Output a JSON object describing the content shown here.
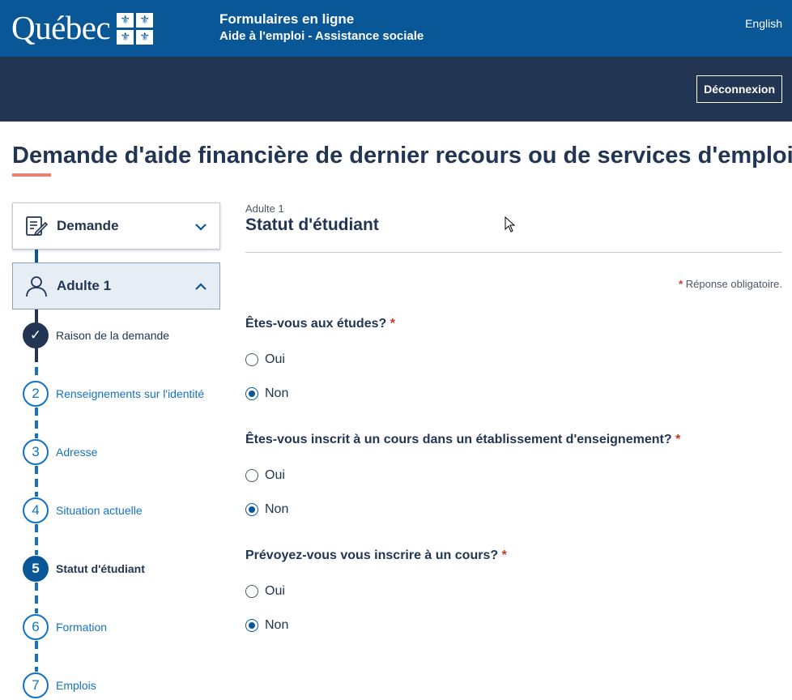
{
  "header": {
    "logo_text": "Québec",
    "app_title": "Formulaires en ligne",
    "app_subtitle": "Aide à l'emploi - Assistance sociale",
    "language_link": "English",
    "logout_label": "Déconnexion"
  },
  "page": {
    "title": "Demande d'aide financière de dernier recours ou de services d'emploi"
  },
  "sidebar": {
    "sections": [
      {
        "label": "Demande",
        "icon": "form-edit-icon",
        "expanded": false
      },
      {
        "label": "Adulte 1",
        "icon": "person-icon",
        "expanded": true
      }
    ],
    "steps": [
      {
        "number": "✓",
        "label": "Raison de la demande",
        "state": "done"
      },
      {
        "number": "2",
        "label": "Renseignements sur l'identité",
        "state": "todo"
      },
      {
        "number": "3",
        "label": "Adresse",
        "state": "todo"
      },
      {
        "number": "4",
        "label": "Situation actuelle",
        "state": "todo"
      },
      {
        "number": "5",
        "label": "Statut d'étudiant",
        "state": "current"
      },
      {
        "number": "6",
        "label": "Formation",
        "state": "todo"
      },
      {
        "number": "7",
        "label": "Emplois",
        "state": "todo"
      }
    ]
  },
  "form": {
    "kicker": "Adulte 1",
    "title": "Statut d'étudiant",
    "required_star": "*",
    "required_note": "Réponse obligatoire.",
    "questions": [
      {
        "label": "Êtes-vous aux études?",
        "options": [
          "Oui",
          "Non"
        ],
        "selected": "Non"
      },
      {
        "label": "Êtes-vous inscrit à un cours dans un établissement d'enseignement?",
        "options": [
          "Oui",
          "Non"
        ],
        "selected": "Non"
      },
      {
        "label": "Prévoyez-vous vous inscrire à un cours?",
        "options": [
          "Oui",
          "Non"
        ],
        "selected": "Non"
      }
    ]
  },
  "colors": {
    "brand_blue": "#095797",
    "navy": "#223654",
    "accent_underline": "#e58271",
    "link_blue": "#1472bf",
    "required_red": "#cb381f"
  }
}
